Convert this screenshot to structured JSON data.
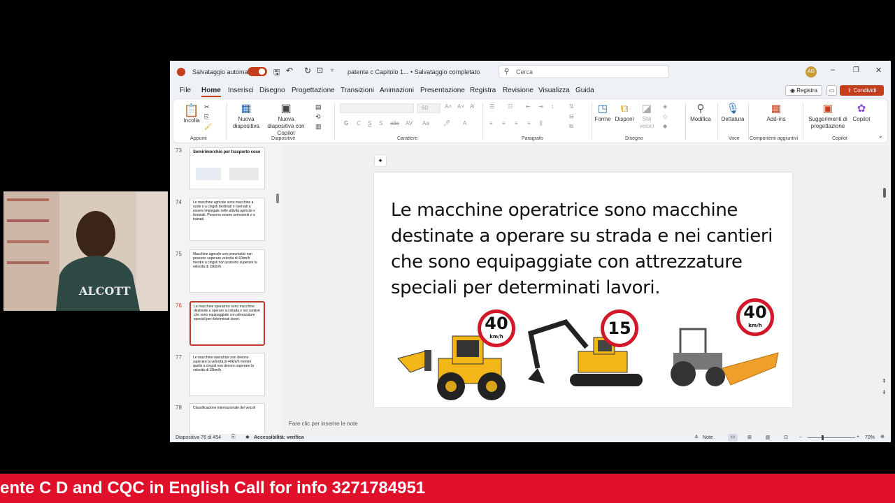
{
  "titlebar": {
    "autosave_label": "Salvataggio automatico",
    "doc_name": "patente c  Capitolo 1...",
    "save_status": "• Salvataggio completato",
    "search_placeholder": "Cerca",
    "avatar_initials": "AG"
  },
  "menu": {
    "tabs": [
      "File",
      "Home",
      "Inserisci",
      "Disegno",
      "Progettazione",
      "Transizioni",
      "Animazioni",
      "Presentazione",
      "Registra",
      "Revisione",
      "Visualizza",
      "Guida"
    ],
    "active": "Home",
    "record_label": "Registra",
    "share_label": "Condividi"
  },
  "ribbon": {
    "paste_label": "Incolla",
    "new_slide_label": "Nuova diapositiva",
    "new_slide_copilot_label": "Nuova diapositiva con Copilot",
    "font_size": "60",
    "shapes_label": "Forme",
    "arrange_label": "Disponi",
    "quick_styles_label": "Stili veloci",
    "edit_label": "Modifica",
    "dictate_label": "Dettatura",
    "addins_label": "Add-ins",
    "suggestions_label": "Suggerimenti di progettazione",
    "copilot_label": "Copilot",
    "groups": {
      "clipboard": "Appunti",
      "slides": "Diapositive",
      "font": "Carattere",
      "paragraph": "Paragrafo",
      "drawing": "Disegno",
      "voice": "Voce",
      "addins": "Componenti aggiuntivi",
      "copilot": "Copilot"
    }
  },
  "thumbnails": [
    {
      "num": "73",
      "text": "Semirimorchio per trasporto cose",
      "selected": false
    },
    {
      "num": "74",
      "text": "Le macchine agricole sono macchine a ruote o a cingoli destinati o riservati a essere impiegate nelle attività agricole e forestali. Possono essere semoventi o a trainati.",
      "selected": false
    },
    {
      "num": "75",
      "text": "Macchine agricole con pneumatici non possono superare velocità di 40km/h mentre a cingoli non possono superare la velocità di 15km/h.",
      "selected": false
    },
    {
      "num": "76",
      "text": "Le macchine operatrice sono macchine destinate a operare su strada e nei cantieri che sono equipaggiate con attrezzature speciali per determinati lavori.",
      "selected": true
    },
    {
      "num": "77",
      "text": "Le macchine operatrice non devono superare la velocità di 40km/h mentre quello a cingoli non devono superare la velocità di 15km/h.",
      "selected": false
    },
    {
      "num": "78",
      "text": "Classificazione internazionale dei veicoli",
      "selected": false
    }
  ],
  "slide": {
    "text": "Le macchine operatrice sono macchine destinate a operare su strada e nei cantieri che sono equipaggiate con attrezzature speciali per determinati lavori.",
    "signs": [
      {
        "value": "40",
        "unit": "km/h"
      },
      {
        "value": "15",
        "unit": ""
      },
      {
        "value": "40",
        "unit": "km/h"
      }
    ]
  },
  "notes_placeholder": "Fare clic per inserire le note",
  "status": {
    "slide_count": "Diapositiva 76 di 454",
    "accessibility": "Accessibilità: verifica",
    "notes": "Note",
    "zoom": "70%"
  },
  "banner_text": "ente C D and CQC in English Call for info 3271784951",
  "colors": {
    "accent": "#c43e1c",
    "banner": "#e0102a",
    "sign_red": "#d3182a",
    "machine_yellow": "#f2b619"
  }
}
